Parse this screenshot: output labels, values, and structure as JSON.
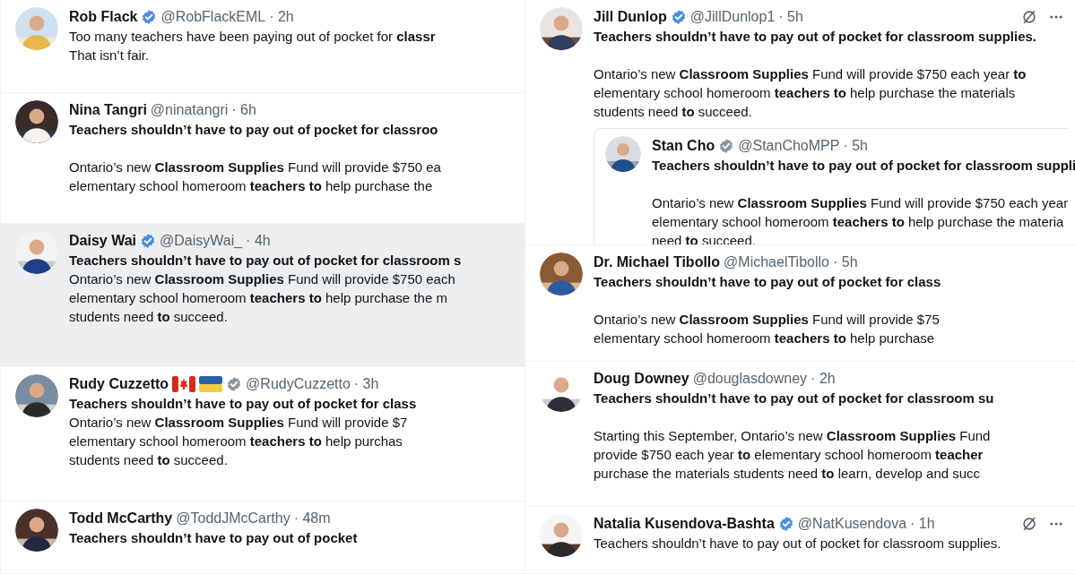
{
  "columns": [
    {
      "tweets": [
        {
          "name": "Rob Flack",
          "badge": {
            "color": "#4a8fe0"
          },
          "handle": "@RobFlackEML",
          "time": "· 2h",
          "highlighted": false,
          "actions_shown": false,
          "spaced": false,
          "body": [
            "Too many teachers have been paying out of pocket for **classr**",
            "That isn’t fair."
          ]
        },
        {
          "name": "Nina Tangri",
          "handle": "@ninatangri",
          "time": "· 6h",
          "highlighted": false,
          "actions_shown": false,
          "headline": "Teachers shouldn’t have to pay out of pocket for classroo",
          "spaced": true,
          "body": [
            "Ontario’s new **Classroom Supplies** Fund will provide $750 ea",
            "elementary school homeroom **teachers to** help purchase the"
          ]
        },
        {
          "name": "Daisy Wai",
          "badge": {
            "color": "#4a8fe0"
          },
          "handle": "@DaisyWai_",
          "time": "· 4h",
          "highlighted": true,
          "actions_shown": false,
          "headline": "Teachers shouldn’t have to pay out of pocket for classroom s",
          "spaced": false,
          "body": [
            "Ontario’s new **Classroom Supplies** Fund will provide $750 each",
            "elementary school homeroom **teachers to** help purchase the m",
            "students need **to** succeed."
          ]
        },
        {
          "name": "Rudy Cuzzetto",
          "flags": [
            {
              "kind": "canada"
            },
            {
              "kind": "ukraine"
            }
          ],
          "badge": {
            "color": "#8a96a3"
          },
          "handle": "@RudyCuzzetto",
          "time": "· 3h",
          "highlighted": false,
          "actions_shown": false,
          "headline": "Teachers shouldn’t have to pay out of pocket for class",
          "spaced": false,
          "body": [
            "Ontario’s new **Classroom Supplies** Fund will provide $7",
            "elementary school homeroom **teachers to** help purchas",
            "students need **to** succeed."
          ]
        },
        {
          "name": "Todd McCarthy",
          "handle": "@ToddJMcCarthy",
          "time": "· 48m",
          "highlighted": false,
          "actions_shown": false,
          "headline": "Teachers shouldn’t have to pay out of pocket",
          "spaced": false
        }
      ]
    },
    {
      "tweets": [
        {
          "name": "Jill Dunlop",
          "badge": {
            "color": "#4a8fe0"
          },
          "handle": "@JillDunlop1",
          "time": "· 5h",
          "highlighted": false,
          "actions_shown": true,
          "headline": "Teachers shouldn’t have to pay out of pocket for classroom supplies.",
          "spaced": true,
          "body": [
            "Ontario’s new **Classroom Supplies** Fund will provide $750 each year **to**",
            "elementary school homeroom **teachers to** help purchase the materials",
            "students need **to** succeed."
          ],
          "quoted": {
            "name": "Stan Cho",
            "badge": {
              "color": "#8a96a3"
            },
            "handle": "@StanChoMPP",
            "time": "· 5h",
            "headline": "Teachers shouldn’t have to pay out of pocket for classroom suppli",
            "spaced": true,
            "body": [
              "Ontario’s new **Classroom Supplies** Fund will provide $750 each year",
              "elementary school homeroom **teachers to** help purchase the materia",
              "need **to** succeed."
            ]
          }
        },
        {
          "name": "Dr. Michael Tibollo",
          "handle": "@MichaelTibollo",
          "time": "· 5h",
          "highlighted": false,
          "actions_shown": false,
          "headline": "Teachers shouldn’t have to pay out of pocket for class",
          "spaced": true,
          "body": [
            "Ontario’s new **Classroom Supplies** Fund will provide $75",
            "elementary school homeroom **teachers to** help purchase"
          ]
        },
        {
          "name": "Doug Downey",
          "handle": "@douglasdowney",
          "time": "· 2h",
          "highlighted": false,
          "actions_shown": false,
          "headline": "Teachers shouldn’t have to pay out of pocket for classroom su",
          "spaced": true,
          "body": [
            "Starting this September, Ontario’s new **Classroom Supplies** Fund",
            "provide $750 each year **to** elementary school homeroom **teacher**",
            "purchase the materials students need **to** learn, develop and succ"
          ]
        },
        {
          "name": "Natalia Kusendova-Bashta",
          "badge": {
            "color": "#4a8fe0"
          },
          "handle": "@NatKusendova",
          "time": "· 1h",
          "highlighted": false,
          "actions_shown": true,
          "spaced": false,
          "body": [
            "Teachers shouldn’t have to pay out of pocket for classroom supplies."
          ]
        }
      ]
    }
  ]
}
